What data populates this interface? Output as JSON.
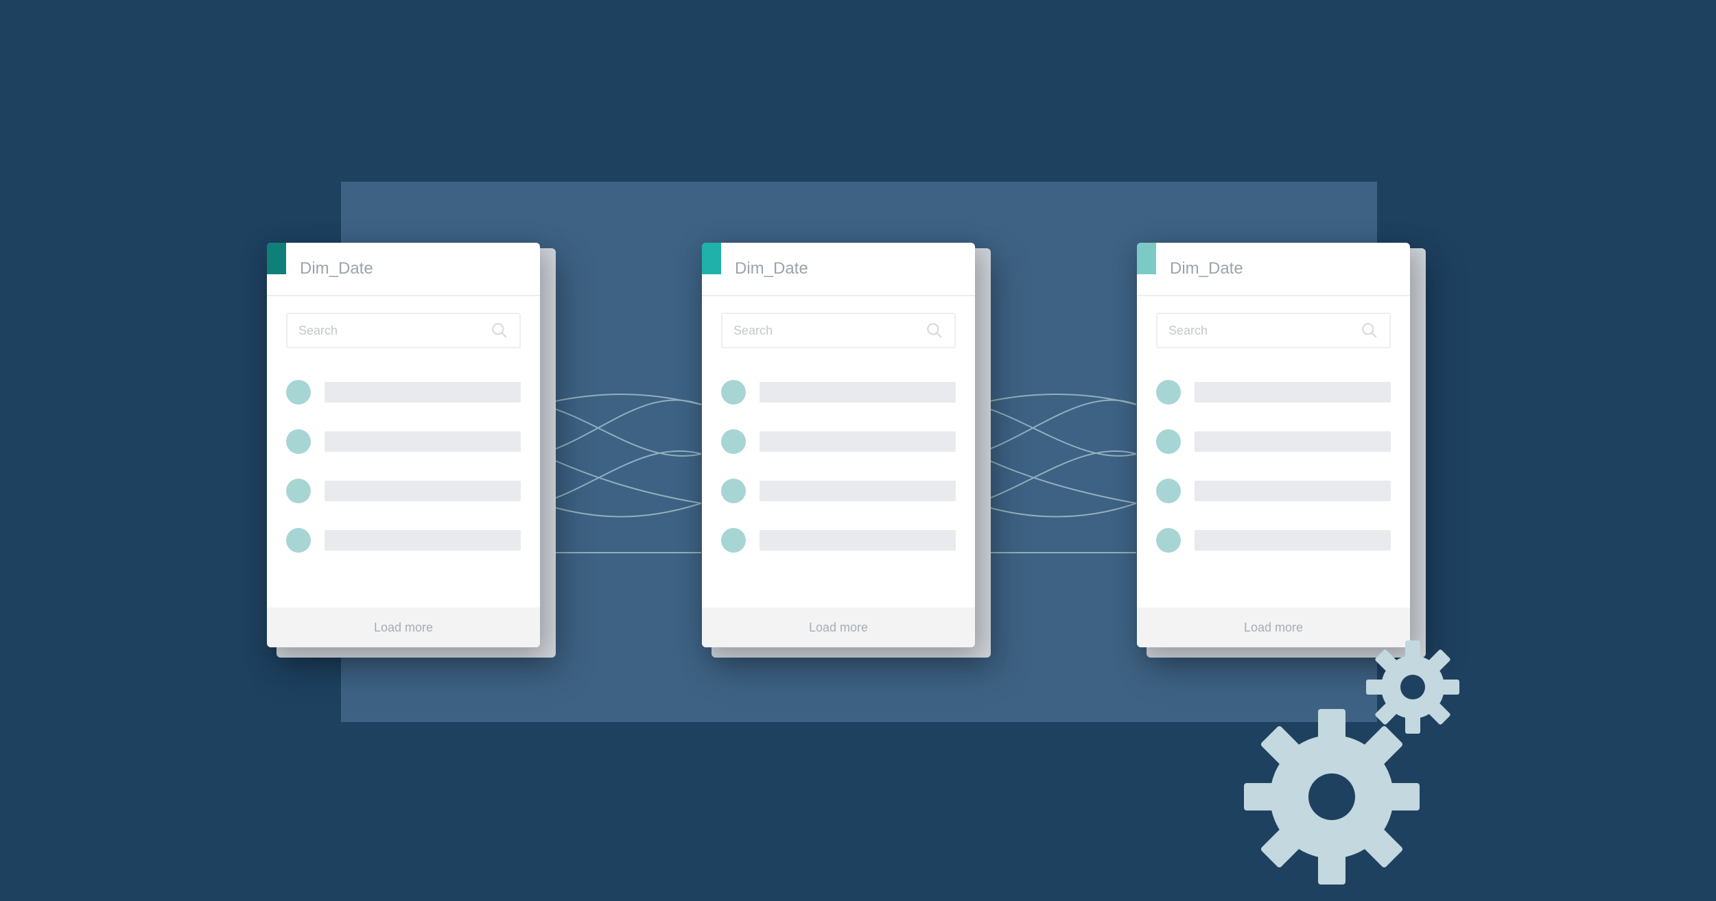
{
  "cards": [
    {
      "title": "Dim_Date",
      "search_placeholder": "Search",
      "load_more": "Load more",
      "accent": "#0f7f7a",
      "rows": 4
    },
    {
      "title": "Dim_Date",
      "search_placeholder": "Search",
      "load_more": "Load more",
      "accent": "#20b2aa",
      "rows": 4
    },
    {
      "title": "Dim_Date",
      "search_placeholder": "Search",
      "load_more": "Load more",
      "accent": "#7ccac5",
      "rows": 4
    }
  ],
  "colors": {
    "background": "#1e4160",
    "backdrop": "#3e6284",
    "gear": "#c3d8df",
    "gear_center": "#1e4160",
    "row_dot": "#a7d5d4",
    "row_bar": "#e8eaed",
    "connection": "#9bb9c7"
  }
}
